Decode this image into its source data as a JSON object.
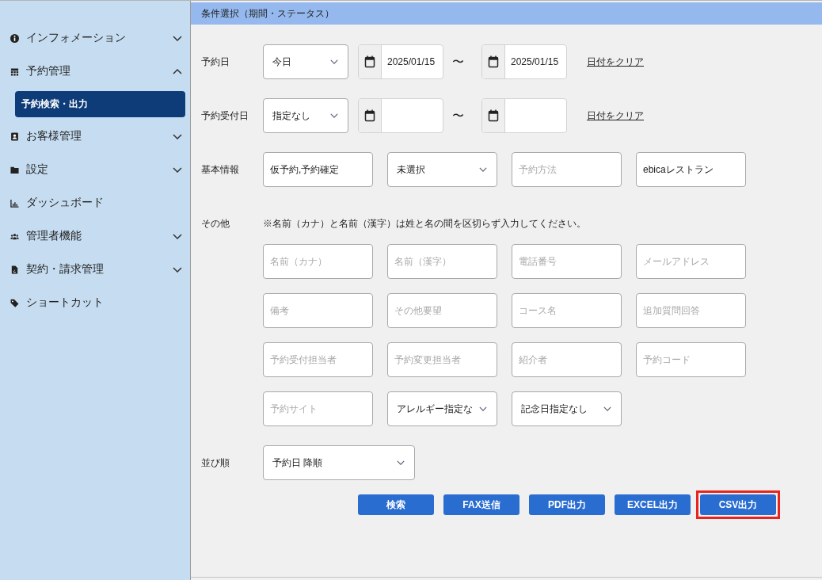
{
  "sidebar": {
    "items": [
      {
        "label": "インフォメーション",
        "kind": "group",
        "expanded": false
      },
      {
        "label": "予約管理",
        "kind": "group",
        "expanded": true,
        "children": [
          {
            "label": "予約検索・出力",
            "selected": true
          }
        ]
      },
      {
        "label": "お客様管理",
        "kind": "group",
        "expanded": false
      },
      {
        "label": "設定",
        "kind": "group",
        "expanded": false
      },
      {
        "label": "ダッシュボード",
        "kind": "link"
      },
      {
        "label": "管理者機能",
        "kind": "group",
        "expanded": false
      },
      {
        "label": "契約・請求管理",
        "kind": "group",
        "expanded": false
      },
      {
        "label": "ショートカット",
        "kind": "link"
      }
    ]
  },
  "panel": {
    "title": "条件選択（期間・ステータス）",
    "rows": [
      {
        "label": "予約日",
        "kind": "date_range",
        "select": {
          "value": "今日"
        },
        "from_date": "2025/01/15",
        "separator": "〜",
        "to_date": "2025/01/15",
        "clear_link": "日付をクリア"
      },
      {
        "label": "予約受付日",
        "kind": "date_range",
        "select": {
          "value": "指定なし"
        },
        "separator": "〜",
        "clear_link": "日付をクリア"
      },
      {
        "label": "基本情報",
        "kind": "fields",
        "fields": [
          {
            "kind": "text",
            "value": "仮予約,予約確定"
          },
          {
            "kind": "select",
            "value": "未選択"
          },
          {
            "kind": "text",
            "placeholder": "予約方法"
          },
          {
            "kind": "text",
            "value": "ebicaレストラン"
          }
        ]
      },
      {
        "label": "その他",
        "kind": "fields",
        "note": "※名前（カナ）と名前（漢字）は姓と名の間を区切らず入力してください。",
        "fields": [
          {
            "kind": "text",
            "placeholder": "名前（カナ）"
          },
          {
            "kind": "text",
            "placeholder": "名前（漢字）"
          },
          {
            "kind": "text",
            "placeholder": "電話番号"
          },
          {
            "kind": "text",
            "placeholder": "メールアドレス"
          },
          {
            "kind": "text",
            "placeholder": "備考"
          },
          {
            "kind": "text",
            "placeholder": "その他要望"
          },
          {
            "kind": "text",
            "placeholder": "コース名"
          },
          {
            "kind": "text",
            "placeholder": "追加質問回答"
          },
          {
            "kind": "text",
            "placeholder": "予約受付担当者"
          },
          {
            "kind": "text",
            "placeholder": "予約変更担当者"
          },
          {
            "kind": "text",
            "placeholder": "紹介者"
          },
          {
            "kind": "text",
            "placeholder": "予約コード"
          },
          {
            "kind": "text",
            "placeholder": "予約サイト"
          },
          {
            "kind": "select",
            "value": "アレルギー指定な"
          },
          {
            "kind": "select",
            "value": "記念日指定なし"
          }
        ]
      },
      {
        "label": "並び順",
        "kind": "sort",
        "select": {
          "value": "予約日 降順"
        }
      }
    ],
    "buttons": [
      {
        "label": "検索",
        "highlighted": false
      },
      {
        "label": "FAX送信",
        "highlighted": false
      },
      {
        "label": "PDF出力",
        "highlighted": false
      },
      {
        "label": "EXCEL出力",
        "highlighted": false
      },
      {
        "label": "CSV出力",
        "highlighted": true
      }
    ]
  }
}
